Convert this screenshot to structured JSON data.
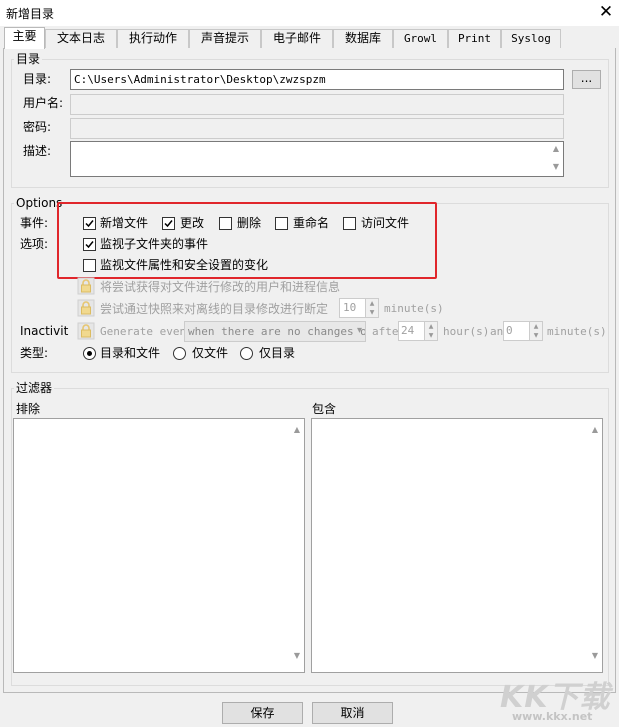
{
  "window": {
    "title": "新增目录",
    "close_glyph": "✕"
  },
  "tabs": [
    {
      "label": "主要",
      "active": true
    },
    {
      "label": "文本日志"
    },
    {
      "label": "执行动作"
    },
    {
      "label": "声音提示"
    },
    {
      "label": "电子邮件"
    },
    {
      "label": "数据库"
    },
    {
      "label": "Growl"
    },
    {
      "label": "Print"
    },
    {
      "label": "Syslog"
    }
  ],
  "directory_group": {
    "label": "目录",
    "path_label": "目录:",
    "path_value": "C:\\Users\\Administrator\\Desktop\\zwzspzm",
    "browse_label": "...",
    "username_label": "用户名:",
    "username_value": "",
    "password_label": "密码:",
    "password_value": "",
    "description_label": "描述:",
    "description_value": ""
  },
  "options_group": {
    "label": "Options",
    "events_label": "事件:",
    "options_label": "选项:",
    "events": [
      {
        "label": "新增文件",
        "checked": true
      },
      {
        "label": "更改",
        "checked": true
      },
      {
        "label": "删除",
        "checked": false
      },
      {
        "label": "重命名",
        "checked": false
      },
      {
        "label": "访问文件",
        "checked": false
      }
    ],
    "watch_subfolders": {
      "label": "监视子文件夹的事件",
      "checked": true
    },
    "watch_attributes": {
      "label": "监视文件属性和安全设置的变化",
      "checked": false
    },
    "capture_user": {
      "label": "将尝试获得对文件进行修改的用户和进程信息",
      "checked": false
    },
    "snapshot": {
      "label": "尝试通过快照来对离线的目录修改进行断定",
      "checked": false,
      "value": "10",
      "unit": "minute(s)"
    },
    "inactivity": {
      "label": "Inactivit",
      "checkbox_label": "Generate event",
      "select_value": "when there are no changes o",
      "after_label": "after",
      "hours_value": "24",
      "hours_unit": "hour(s)",
      "and_label": "an",
      "minutes_value": "0",
      "minutes_unit": "minute(s)"
    },
    "type_label": "类型:",
    "types": [
      {
        "label": "目录和文件",
        "selected": true
      },
      {
        "label": "仅文件",
        "selected": false
      },
      {
        "label": "仅目录",
        "selected": false
      }
    ]
  },
  "filter_group": {
    "label": "过滤器",
    "exclude_label": "排除",
    "include_label": "包含"
  },
  "buttons": {
    "save": "保存",
    "cancel": "取消"
  },
  "watermark": {
    "main": "KK下载",
    "url": "www.kkx.net"
  },
  "colors": {
    "highlight": "#e0262b",
    "window_bg": "#f0f0f0"
  }
}
